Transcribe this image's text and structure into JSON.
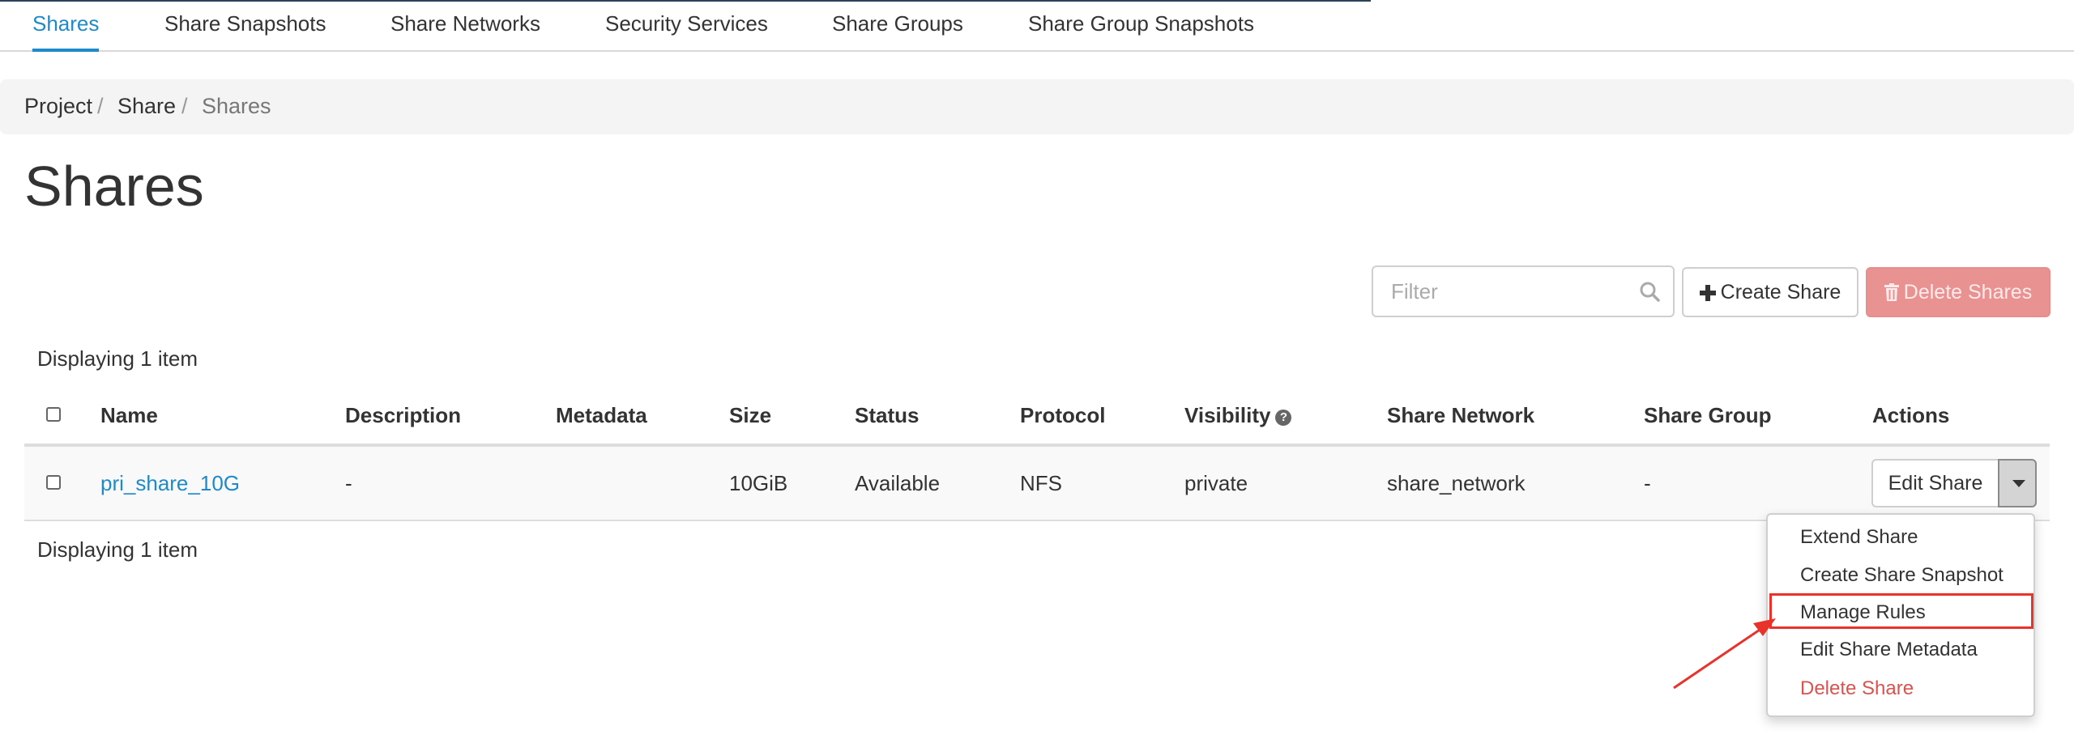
{
  "tabs": [
    {
      "label": "Shares",
      "active": true
    },
    {
      "label": "Share Snapshots"
    },
    {
      "label": "Share Networks"
    },
    {
      "label": "Security Services"
    },
    {
      "label": "Share Groups"
    },
    {
      "label": "Share Group Snapshots"
    }
  ],
  "breadcrumb": [
    "Project",
    "Share",
    "Shares"
  ],
  "page_title": "Shares",
  "toolbar": {
    "filter_placeholder": "Filter",
    "create_label": "Create Share",
    "delete_label": "Delete Shares"
  },
  "display_count": "Displaying 1 item",
  "table": {
    "columns": [
      "Name",
      "Description",
      "Metadata",
      "Size",
      "Status",
      "Protocol",
      "Visibility",
      "Share Network",
      "Share Group",
      "Actions"
    ],
    "rows": [
      {
        "name": "pri_share_10G",
        "description": "-",
        "metadata": "",
        "size": "10GiB",
        "status": "Available",
        "protocol": "NFS",
        "visibility": "private",
        "share_network": "share_network",
        "share_group": "-",
        "action_label": "Edit Share"
      }
    ]
  },
  "actions_menu": [
    {
      "label": "Extend Share"
    },
    {
      "label": "Create Share Snapshot"
    },
    {
      "label": "Manage Rules",
      "highlighted": true
    },
    {
      "label": "Edit Share Metadata"
    },
    {
      "label": "Delete Share",
      "danger": true
    }
  ],
  "colors": {
    "accent": "#1f8ac9",
    "danger": "#d9534f",
    "annotation": "#e8332a"
  }
}
